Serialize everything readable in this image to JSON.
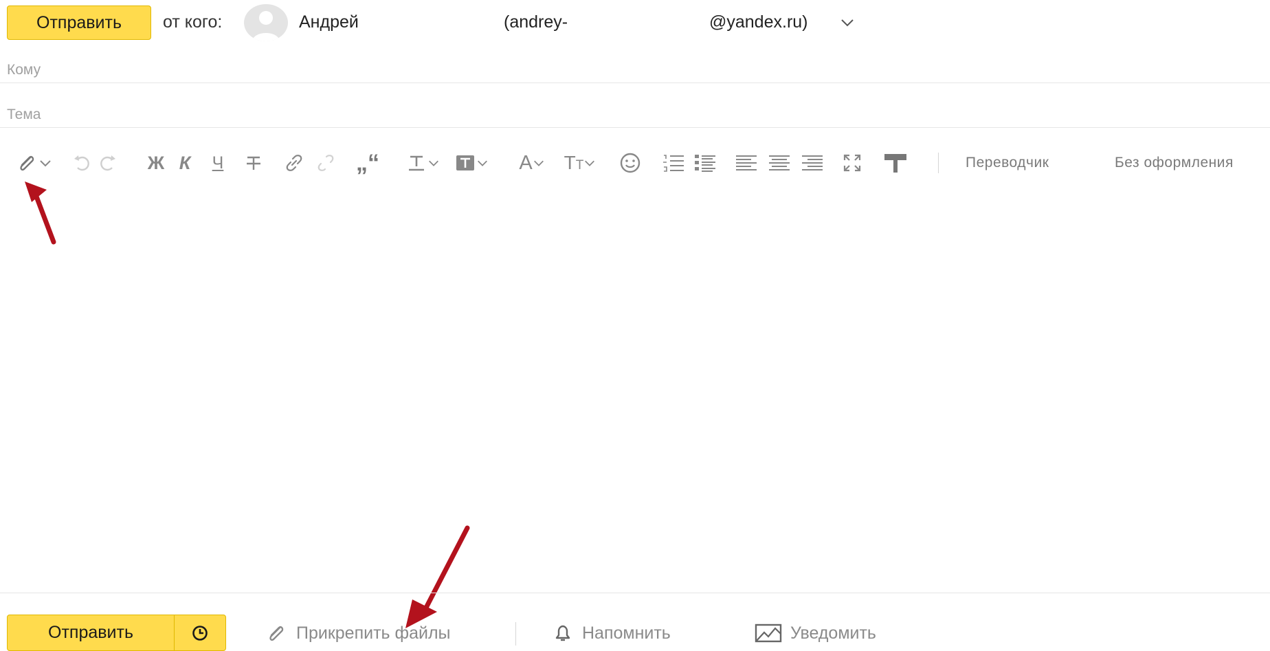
{
  "header": {
    "send_label": "Отправить",
    "from_label": "от кого:",
    "sender_name": "Андрей",
    "email_left": "(andrey-",
    "email_right": "@yandex.ru)"
  },
  "fields": {
    "to_placeholder": "Кому",
    "subject_placeholder": "Тема"
  },
  "toolbar": {
    "translator_label": "Переводчик",
    "no_format_label": "Без оформления",
    "icons": [
      "paperclip-icon",
      "undo-icon",
      "redo-icon",
      "bold-icon",
      "italic-icon",
      "underline-icon",
      "strikethrough-icon",
      "link-icon",
      "unlink-icon",
      "quote-icon",
      "text-color-icon",
      "background-color-icon",
      "font-icon",
      "font-size-icon",
      "emoji-icon",
      "numbered-list-icon",
      "bulleted-list-icon",
      "align-left-icon",
      "align-center-icon",
      "align-right-icon",
      "fullscreen-icon",
      "clear-format-icon"
    ]
  },
  "footer": {
    "send_label": "Отправить",
    "attach_label": "Прикрепить файлы",
    "remind_label": "Напомнить",
    "notify_label": "Уведомить"
  },
  "colors": {
    "accent_yellow": "#ffdb4d",
    "arrow_red": "#b3121d"
  }
}
